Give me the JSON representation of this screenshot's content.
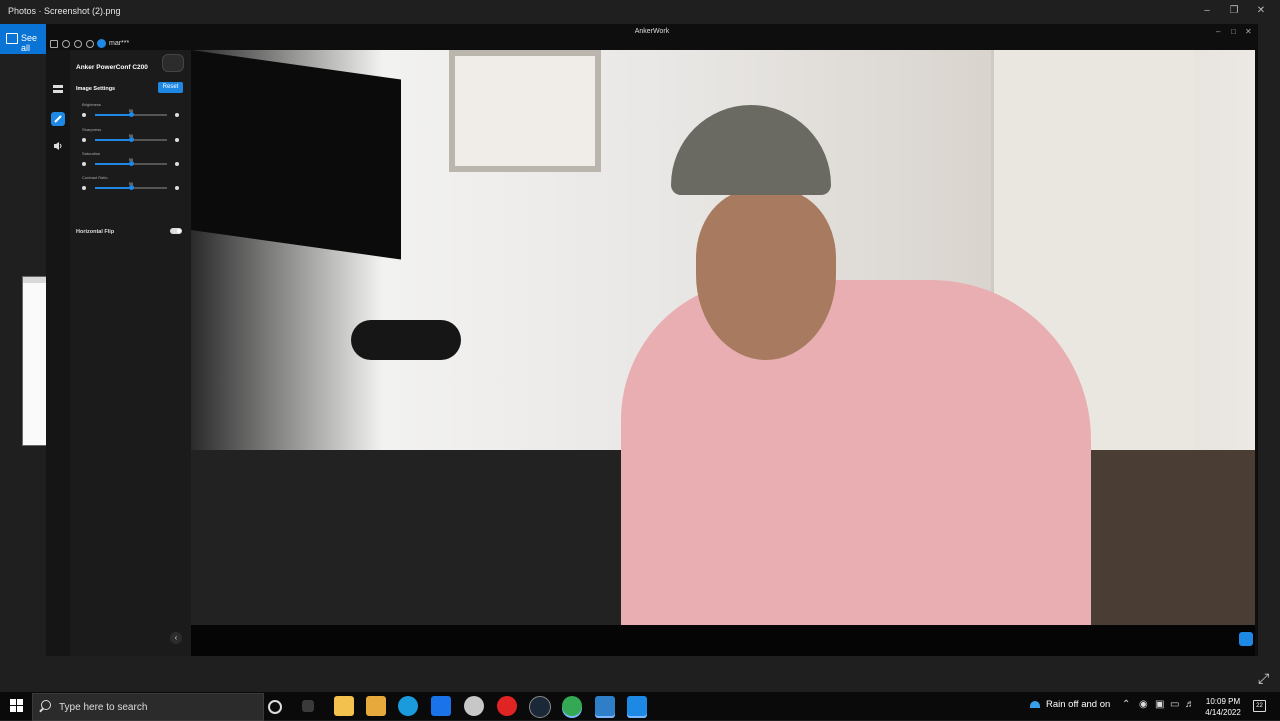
{
  "photos": {
    "title": "Photos · Screenshot (2).png",
    "see_all": "See all"
  },
  "anker": {
    "window_title": "AnkerWork",
    "username": "mar***",
    "device_name": "Anker PowerConf C200",
    "section_title": "Image Settings",
    "reset_label": "Reset",
    "sliders": [
      {
        "label": "Brightness",
        "value": 50,
        "fraction": 0.5
      },
      {
        "label": "Sharpness",
        "value": 50,
        "fraction": 0.5
      },
      {
        "label": "Saturation",
        "value": 50,
        "fraction": 0.5
      },
      {
        "label": "Contrast Ratio",
        "value": 50,
        "fraction": 0.5
      }
    ],
    "horizontal_flip_label": "Horizontal Flip",
    "horizontal_flip_on": true,
    "nav": [
      "camera-settings-icon",
      "image-settings-icon",
      "audio-icon"
    ]
  },
  "taskbar": {
    "search_placeholder": "Type here to search",
    "apps": [
      "task-view-icon",
      "file-explorer-icon",
      "store-icon",
      "edge-icon",
      "mail-icon",
      "app-icon",
      "app-icon",
      "steam-icon",
      "chrome-icon",
      "photos-icon",
      "ankerwork-icon"
    ],
    "weather": "Rain off and on",
    "time": "10:09 PM",
    "date": "4/14/2022",
    "notification_count": "22"
  },
  "colors": {
    "accent": "#1e88e5",
    "taskbar": "#0a0a0a",
    "panel": "#1b1b1b"
  }
}
